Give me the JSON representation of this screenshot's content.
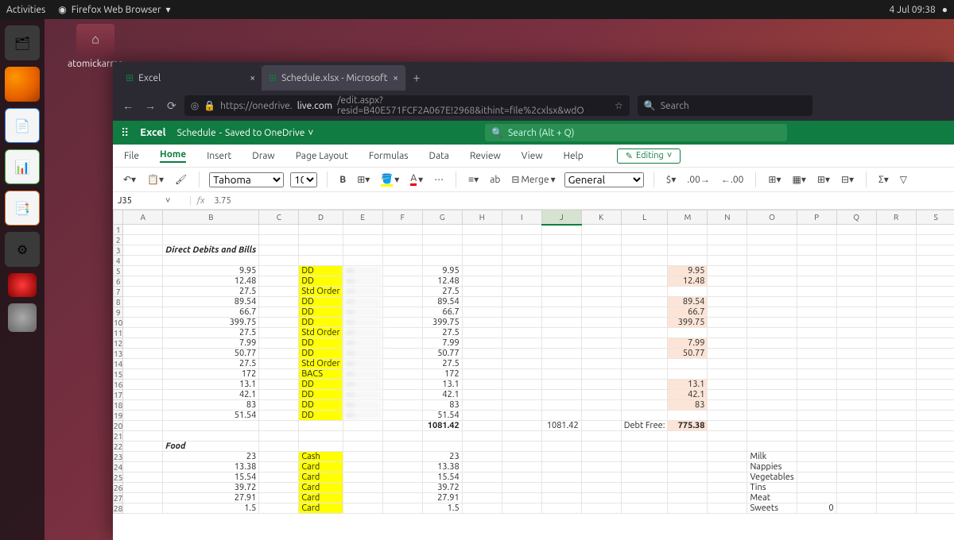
{
  "topbar": {
    "activities": "Activities",
    "app": "Firefox Web Browser",
    "clock": "4 Jul 09:38"
  },
  "desktop": {
    "folder_label": "atomickarma"
  },
  "firefox": {
    "tabs": [
      {
        "label": "Excel"
      },
      {
        "label": "Schedule.xlsx - Microsoft"
      }
    ],
    "url_prefix": "https://onedrive.",
    "url_host": "live.com",
    "url_path": "/edit.aspx?resid=B40E571FCF2A067E!2968&ithint=file%2cxlsx&wdO",
    "search_placeholder": "Search"
  },
  "excel": {
    "app": "Excel",
    "doc": "Schedule",
    "saved": "Saved to OneDrive",
    "search_placeholder": "Search (Alt + Q)",
    "ribbon": {
      "file": "File",
      "home": "Home",
      "insert": "Insert",
      "draw": "Draw",
      "pagelayout": "Page Layout",
      "formulas": "Formulas",
      "data": "Data",
      "review": "Review",
      "view": "View",
      "help": "Help",
      "editing": "Editing"
    },
    "tools": {
      "font": "Tahoma",
      "size": "10",
      "merge": "Merge",
      "numfmt": "General"
    },
    "namebox": "J35",
    "formula": "3.75",
    "columns": [
      "A",
      "B",
      "C",
      "D",
      "E",
      "F",
      "G",
      "H",
      "I",
      "J",
      "K",
      "L",
      "M",
      "N",
      "O",
      "P",
      "Q",
      "R",
      "S"
    ],
    "headers": {
      "bills": "Direct Debits and Bills",
      "food": "Food",
      "debtfree": "Debt Free:"
    },
    "bills": [
      {
        "b": "9.95",
        "d": "DD",
        "g": "9.95",
        "m": "9.95"
      },
      {
        "b": "12.48",
        "d": "DD",
        "g": "12.48",
        "m": "12.48"
      },
      {
        "b": "27.5",
        "d": "Std Order",
        "g": "27.5",
        "m": ""
      },
      {
        "b": "89.54",
        "d": "DD",
        "g": "89.54",
        "m": "89.54"
      },
      {
        "b": "66.7",
        "d": "DD",
        "g": "66.7",
        "m": "66.7"
      },
      {
        "b": "399.75",
        "d": "DD",
        "g": "399.75",
        "m": "399.75"
      },
      {
        "b": "27.5",
        "d": "Std Order",
        "g": "27.5",
        "m": ""
      },
      {
        "b": "7.99",
        "d": "DD",
        "g": "7.99",
        "m": "7.99"
      },
      {
        "b": "50.77",
        "d": "DD",
        "g": "50.77",
        "m": "50.77"
      },
      {
        "b": "27.5",
        "d": "Std Order",
        "g": "27.5",
        "m": ""
      },
      {
        "b": "172",
        "d": "BACS",
        "g": "172",
        "m": ""
      },
      {
        "b": "13.1",
        "d": "DD",
        "g": "13.1",
        "m": "13.1"
      },
      {
        "b": "42.1",
        "d": "DD",
        "g": "42.1",
        "m": "42.1"
      },
      {
        "b": "83",
        "d": "DD",
        "g": "83",
        "m": "83"
      },
      {
        "b": "51.54",
        "d": "DD",
        "g": "51.54",
        "m": ""
      }
    ],
    "totals": {
      "g": "1081.42",
      "j": "1081.42",
      "m": "775.38"
    },
    "food": [
      {
        "b": "23",
        "d": "Cash",
        "g": "23",
        "o": "Milk"
      },
      {
        "b": "13.38",
        "d": "Card",
        "g": "13.38",
        "o": "Nappies"
      },
      {
        "b": "15.54",
        "d": "Card",
        "g": "15.54",
        "o": "Vegetables"
      },
      {
        "b": "39.72",
        "d": "Card",
        "g": "39.72",
        "o": "Tins"
      },
      {
        "b": "27.91",
        "d": "Card",
        "g": "27.91",
        "o": "Meat"
      },
      {
        "b": "1.5",
        "d": "Card",
        "g": "1.5",
        "o": "Sweets",
        "p": "0"
      }
    ]
  }
}
